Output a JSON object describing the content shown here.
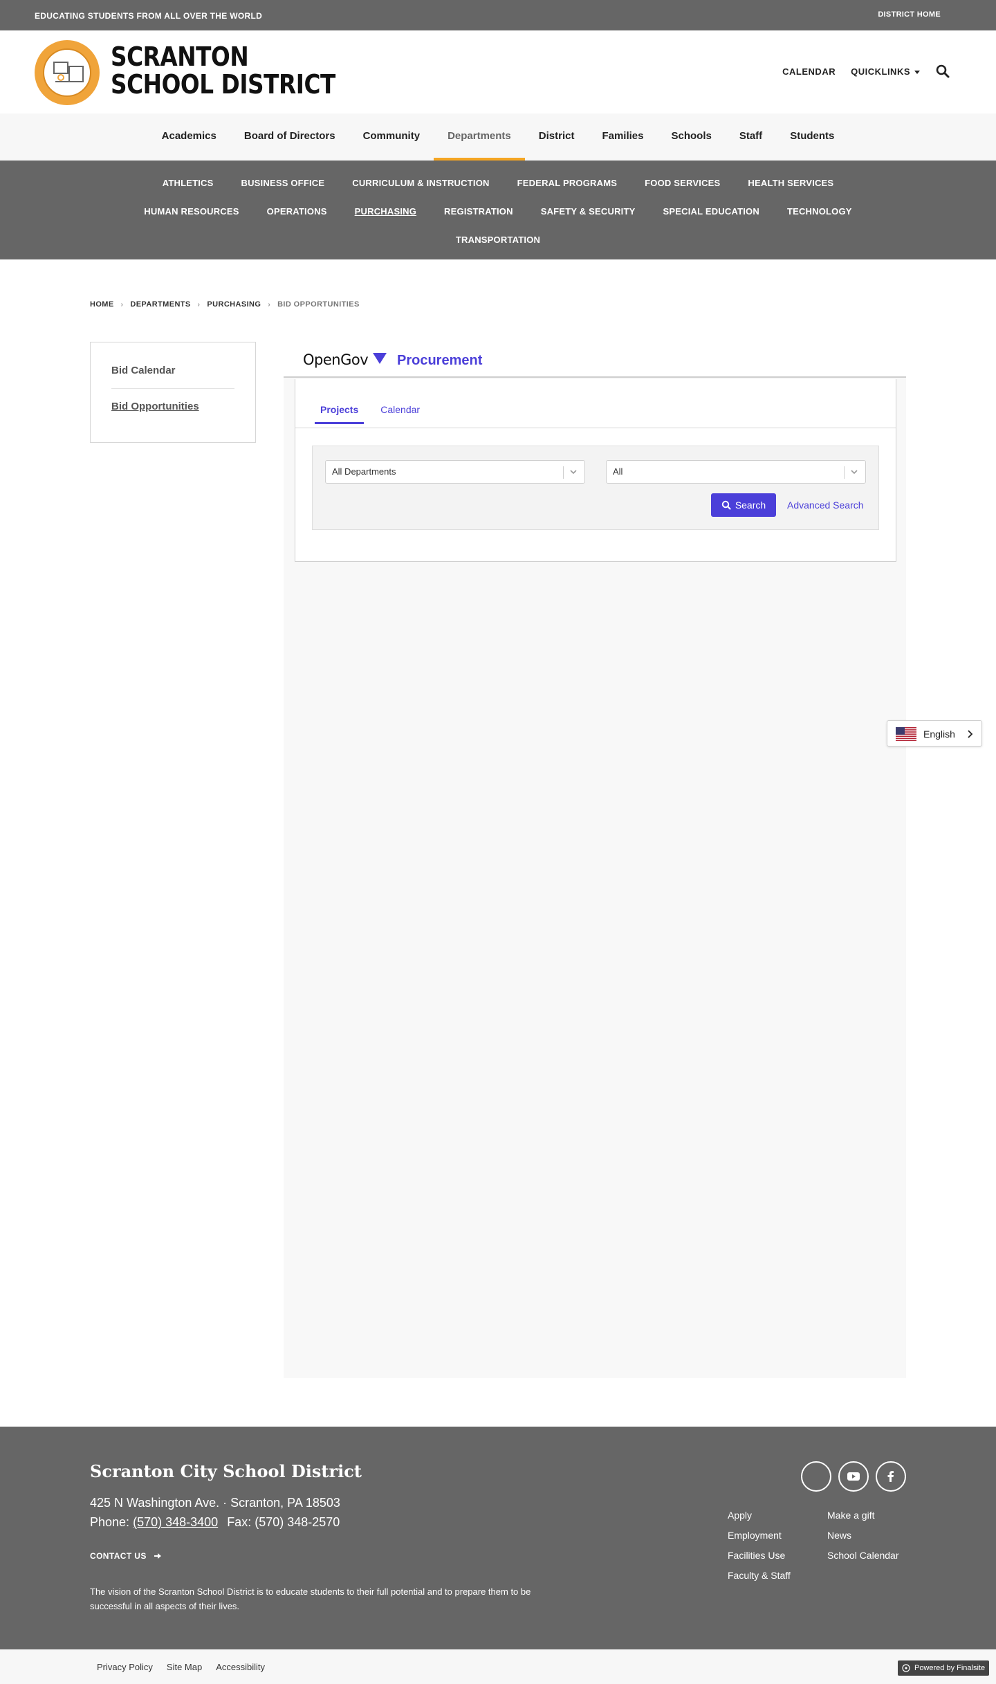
{
  "topbar": {
    "tagline": "EDUCATING STUDENTS FROM ALL OVER THE WORLD",
    "district_home": "DISTRICT HOME"
  },
  "header": {
    "logo_line1": "SCRANTON",
    "logo_line2": "SCHOOL DISTRICT",
    "links": {
      "calendar": "CALENDAR",
      "quicklinks": "QUICKLINKS"
    }
  },
  "main_nav": {
    "items": [
      {
        "label": "Academics"
      },
      {
        "label": "Board of Directors"
      },
      {
        "label": "Community"
      },
      {
        "label": "Departments"
      },
      {
        "label": "District"
      },
      {
        "label": "Families"
      },
      {
        "label": "Schools"
      },
      {
        "label": "Staff"
      },
      {
        "label": "Students"
      }
    ],
    "active_index": 3
  },
  "sub_nav": {
    "row1": [
      "ATHLETICS",
      "BUSINESS OFFICE",
      "CURRICULUM & INSTRUCTION",
      "FEDERAL PROGRAMS",
      "FOOD SERVICES",
      "HEALTH SERVICES"
    ],
    "row2": [
      "HUMAN RESOURCES",
      "OPERATIONS",
      "PURCHASING",
      "REGISTRATION",
      "SAFETY & SECURITY",
      "SPECIAL EDUCATION",
      "TECHNOLOGY"
    ],
    "row3": [
      "TRANSPORTATION"
    ],
    "current": "PURCHASING"
  },
  "breadcrumb": [
    "HOME",
    "DEPARTMENTS",
    "PURCHASING",
    "BID OPPORTUNITIES"
  ],
  "sidebar": {
    "items": [
      {
        "label": "Bid Calendar"
      },
      {
        "label": "Bid Opportunities"
      }
    ]
  },
  "opengov": {
    "brand": "OpenGov",
    "product": "Procurement",
    "tabs": [
      {
        "label": "Projects"
      },
      {
        "label": "Calendar"
      }
    ],
    "department_select": "All Departments",
    "status_select": "All",
    "search_button": "Search",
    "advanced_search": "Advanced Search",
    "accent_color": "#4b3fd9"
  },
  "language": {
    "label": "English"
  },
  "footer": {
    "name": "Scranton City School District",
    "address": "425 N Washington Ave.  · Scranton, PA  18503",
    "phone_label": "Phone:",
    "phone": "(570) 348-3400",
    "fax": "Fax: (570) 348-2570",
    "contact_us": "CONTACT US",
    "vision": "The vision of the Scranton School District is to educate students to their full potential and to prepare them to be successful in all aspects of their lives.",
    "links_col1": [
      "Apply",
      "Employment",
      "Facilities Use",
      "Faculty & Staff"
    ],
    "links_col2": [
      "Make a gift",
      "News",
      "School Calendar"
    ]
  },
  "bottom_bar": {
    "links": [
      "Privacy Policy",
      "Site Map",
      "Accessibility"
    ],
    "powered_by": "Powered by Finalsite"
  },
  "colors": {
    "topbar_bg": "#666666",
    "nav_active_underline": "#f5a623",
    "logo_orange": "#f0a43a"
  }
}
